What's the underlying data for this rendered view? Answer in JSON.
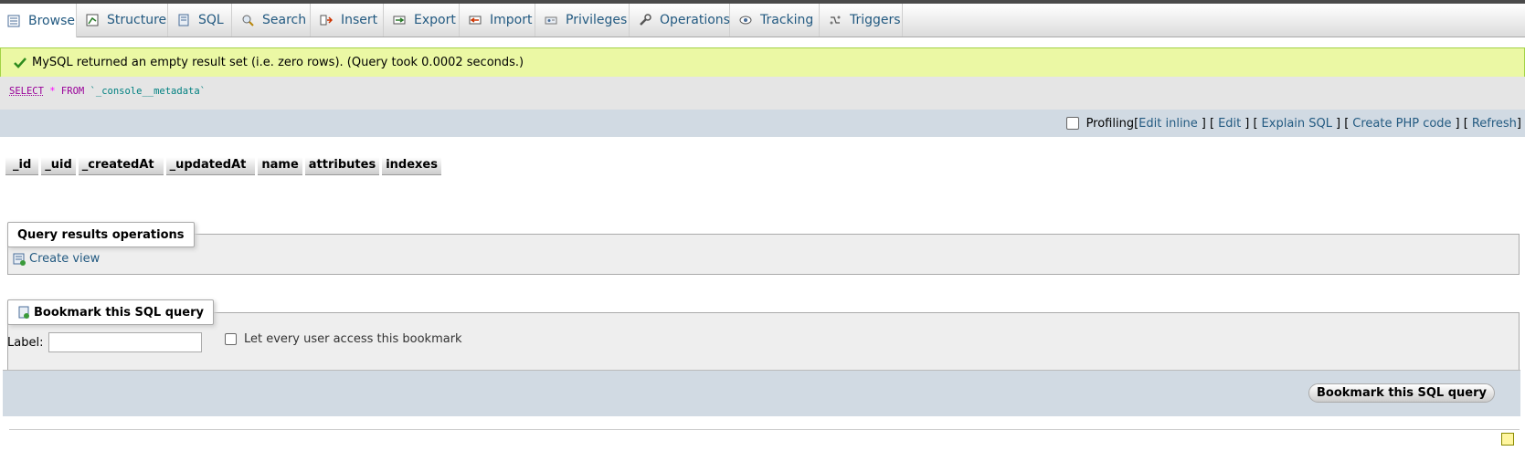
{
  "tabs": [
    {
      "label": "Browse",
      "icon": "browse-icon",
      "active": true
    },
    {
      "label": "Structure",
      "icon": "structure-icon"
    },
    {
      "label": "SQL",
      "icon": "sql-icon"
    },
    {
      "label": "Search",
      "icon": "search-icon"
    },
    {
      "label": "Insert",
      "icon": "insert-icon"
    },
    {
      "label": "Export",
      "icon": "export-icon"
    },
    {
      "label": "Import",
      "icon": "import-icon"
    },
    {
      "label": "Privileges",
      "icon": "privileges-icon"
    },
    {
      "label": "Operations",
      "icon": "operations-icon"
    },
    {
      "label": "Tracking",
      "icon": "tracking-icon"
    },
    {
      "label": "Triggers",
      "icon": "triggers-icon"
    }
  ],
  "message": {
    "text": "MySQL returned an empty result set (i.e. zero rows). (Query took 0.0002 seconds.)"
  },
  "sql": {
    "select": "SELECT",
    "star": "*",
    "from": "FROM",
    "table": "`_console__metadata`"
  },
  "tools": {
    "profiling": "Profiling",
    "open1": "[",
    "edit_inline": "Edit inline",
    "sep1": "] [",
    "edit": "Edit",
    "sep2": "] [",
    "explain": "Explain SQL",
    "sep3": "] [",
    "create_php": "Create PHP code",
    "sep4": "] [",
    "refresh": "Refresh",
    "close": "]"
  },
  "columns": [
    "_id",
    "_uid",
    "_createdAt",
    "_updatedAt",
    "name",
    "attributes",
    "indexes"
  ],
  "query_ops": {
    "legend": "Query results operations",
    "create_view": "Create view"
  },
  "bookmark": {
    "legend": "Bookmark this SQL query",
    "label": "Label:",
    "label_value": "",
    "every_user": "Let every user access this bookmark",
    "button": "Bookmark this SQL query"
  },
  "colors": {
    "link": "#235a81",
    "success_bg": "#ebf8a4",
    "bar_bg": "#d1dae3"
  }
}
